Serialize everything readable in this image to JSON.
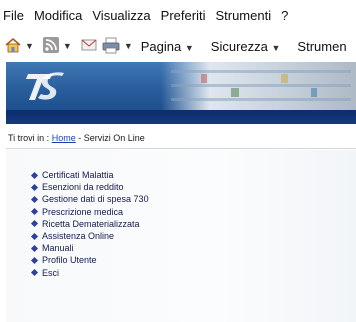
{
  "menubar": {
    "items": [
      "File",
      "Modifica",
      "Visualizza",
      "Preferiti",
      "Strumenti",
      "?"
    ]
  },
  "toolbar": {
    "page_label": "Pagina",
    "security_label": "Sicurezza",
    "tools_label": "Strumen"
  },
  "banner": {
    "logo_text": "TS"
  },
  "breadcrumb": {
    "prefix": "Ti trovi in :",
    "home": "Home",
    "separator": "-",
    "current": "Servizi On Line"
  },
  "services": [
    "Certificati Malattia",
    "Esenzioni da reddito",
    "Gestione dati di spesa 730",
    "Prescrizione medica",
    "Ricetta Dematerializzata",
    "Assistenza Online",
    "Manuali",
    "Profilo Utente",
    "Esci"
  ]
}
